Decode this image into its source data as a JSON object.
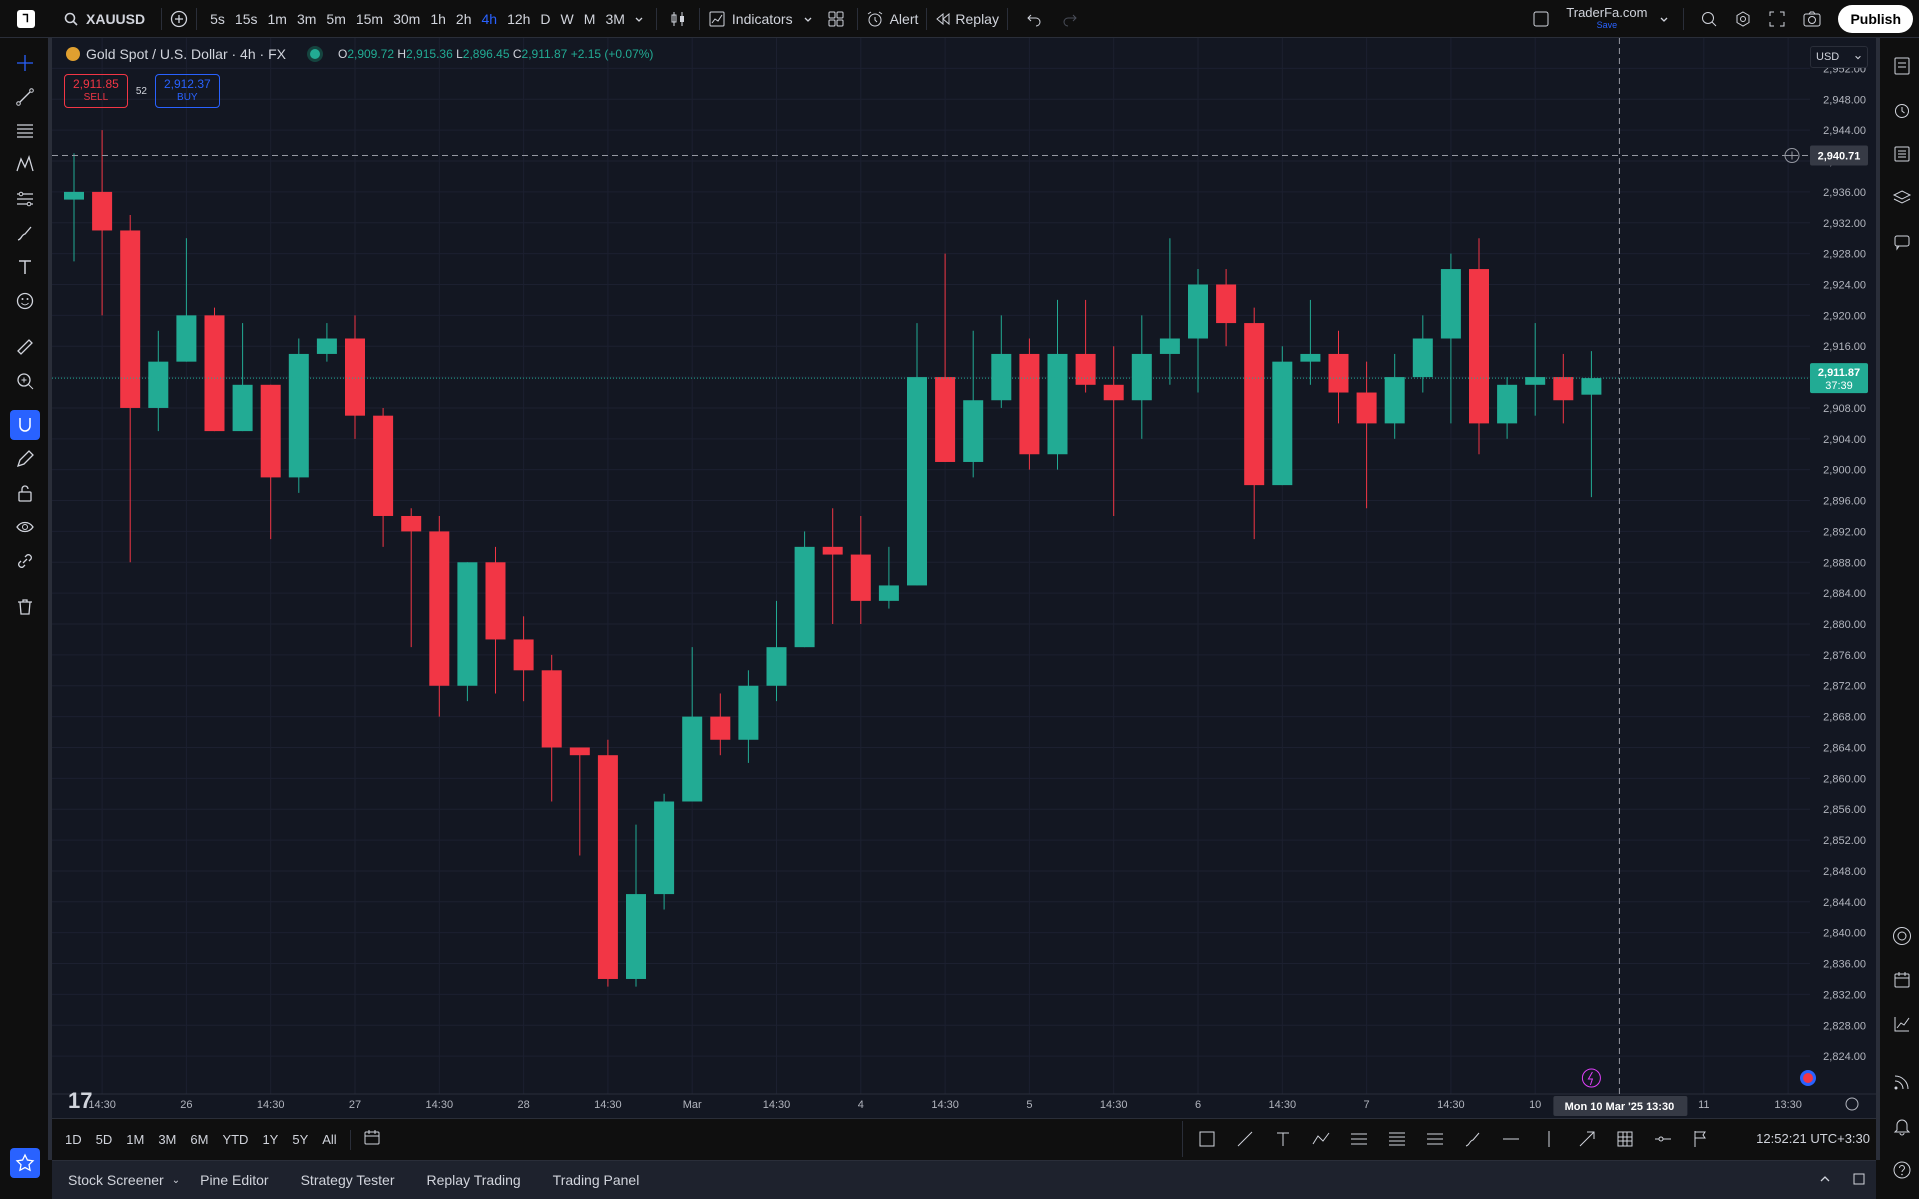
{
  "topbar": {
    "symbol": "XAUUSD",
    "intervals": [
      "5s",
      "15s",
      "1m",
      "3m",
      "5m",
      "15m",
      "30m",
      "1h",
      "2h",
      "4h",
      "12h",
      "D",
      "W",
      "M",
      "3M"
    ],
    "active_interval": "4h",
    "indicators": "Indicators",
    "alert": "Alert",
    "replay": "Replay",
    "layout_name": "TraderFa.com",
    "layout_status": "Save",
    "publish": "Publish"
  },
  "legend": {
    "title": "Gold Spot / U.S. Dollar · 4h · FX",
    "o_label": "O",
    "o": "2,909.72",
    "h_label": "H",
    "h": "2,915.36",
    "l_label": "L",
    "l": "2,896.45",
    "c_label": "C",
    "c": "2,911.87",
    "change": "+2.15 (+0.07%)"
  },
  "trade": {
    "sell_price": "2,911.85",
    "sell": "SELL",
    "spread": "52",
    "buy_price": "2,912.37",
    "buy": "BUY"
  },
  "price_axis": {
    "currency": "USD",
    "crosshair_price": "2,940.71",
    "last_price": "2,911.87",
    "countdown": "37:39"
  },
  "time_axis": {
    "crosshair_label": "Mon 10 Mar '25   13:30"
  },
  "bottombar": {
    "ranges": [
      "1D",
      "5D",
      "1M",
      "3M",
      "6M",
      "YTD",
      "1Y",
      "5Y",
      "All"
    ],
    "clock": "12:52:21 UTC+3:30"
  },
  "footer": {
    "tabs": [
      "Stock Screener",
      "Pine Editor",
      "Strategy Tester",
      "Replay Trading",
      "Trading Panel"
    ]
  },
  "colors": {
    "up": "#22ab94",
    "down": "#f23645",
    "background": "#131722",
    "accent": "#2962ff"
  },
  "chart_data": {
    "type": "candlestick",
    "ylim": [
      2820,
      2956
    ],
    "y_ticks": [
      2952,
      2948,
      2944,
      2940,
      2936,
      2932,
      2928,
      2924,
      2920,
      2916,
      2912,
      2908,
      2904,
      2900,
      2896,
      2892,
      2888,
      2884,
      2880,
      2876,
      2872,
      2868,
      2864,
      2860,
      2856,
      2852,
      2848,
      2844,
      2840,
      2836,
      2832,
      2828,
      2824
    ],
    "y_tick_labels": [
      "2,952.00",
      "2,948.00",
      "2,944.00",
      "2,940.00",
      "2,936.00",
      "2,932.00",
      "2,928.00",
      "2,924.00",
      "2,920.00",
      "2,916.00",
      "2,912.00",
      "2,908.00",
      "2,904.00",
      "2,900.00",
      "2,896.00",
      "2,892.00",
      "2,888.00",
      "2,884.00",
      "2,880.00",
      "2,876.00",
      "2,872.00",
      "2,868.00",
      "2,864.00",
      "2,860.00",
      "2,856.00",
      "2,852.00",
      "2,848.00",
      "2,844.00",
      "2,840.00",
      "2,836.00",
      "2,832.00",
      "2,828.00",
      "2,824.00"
    ],
    "x_ticks": [
      {
        "label": "14:30",
        "i": 1
      },
      {
        "label": "26",
        "i": 4
      },
      {
        "label": "14:30",
        "i": 7
      },
      {
        "label": "27",
        "i": 10
      },
      {
        "label": "14:30",
        "i": 13
      },
      {
        "label": "28",
        "i": 16
      },
      {
        "label": "14:30",
        "i": 19
      },
      {
        "label": "Mar",
        "i": 22
      },
      {
        "label": "14:30",
        "i": 25
      },
      {
        "label": "4",
        "i": 28
      },
      {
        "label": "14:30",
        "i": 31
      },
      {
        "label": "5",
        "i": 34
      },
      {
        "label": "14:30",
        "i": 37
      },
      {
        "label": "6",
        "i": 40
      },
      {
        "label": "14:30",
        "i": 43
      },
      {
        "label": "7",
        "i": 46
      },
      {
        "label": "14:30",
        "i": 49
      },
      {
        "label": "10",
        "i": 52
      },
      {
        "label": "11",
        "i": 58
      },
      {
        "label": "13:30",
        "i": 61
      }
    ],
    "candles": [
      {
        "o": 2935,
        "h": 2941,
        "l": 2927,
        "c": 2936
      },
      {
        "o": 2936,
        "h": 2944,
        "l": 2920,
        "c": 2931
      },
      {
        "o": 2931,
        "h": 2933,
        "l": 2888,
        "c": 2908
      },
      {
        "o": 2908,
        "h": 2918,
        "l": 2905,
        "c": 2914
      },
      {
        "o": 2914,
        "h": 2930,
        "l": 2914,
        "c": 2920
      },
      {
        "o": 2920,
        "h": 2921,
        "l": 2905,
        "c": 2905
      },
      {
        "o": 2905,
        "h": 2919,
        "l": 2905,
        "c": 2911
      },
      {
        "o": 2911,
        "h": 2911,
        "l": 2891,
        "c": 2899
      },
      {
        "o": 2899,
        "h": 2917,
        "l": 2897,
        "c": 2915
      },
      {
        "o": 2915,
        "h": 2919,
        "l": 2914,
        "c": 2917
      },
      {
        "o": 2917,
        "h": 2920,
        "l": 2904,
        "c": 2907
      },
      {
        "o": 2907,
        "h": 2908,
        "l": 2890,
        "c": 2894
      },
      {
        "o": 2894,
        "h": 2895,
        "l": 2877,
        "c": 2892
      },
      {
        "o": 2892,
        "h": 2894,
        "l": 2868,
        "c": 2872
      },
      {
        "o": 2872,
        "h": 2888,
        "l": 2870,
        "c": 2888
      },
      {
        "o": 2888,
        "h": 2890,
        "l": 2871,
        "c": 2878
      },
      {
        "o": 2878,
        "h": 2881,
        "l": 2870,
        "c": 2874
      },
      {
        "o": 2874,
        "h": 2876,
        "l": 2857,
        "c": 2864
      },
      {
        "o": 2864,
        "h": 2864,
        "l": 2850,
        "c": 2863
      },
      {
        "o": 2863,
        "h": 2865,
        "l": 2833,
        "c": 2834
      },
      {
        "o": 2834,
        "h": 2854,
        "l": 2833,
        "c": 2845
      },
      {
        "o": 2845,
        "h": 2858,
        "l": 2843,
        "c": 2857
      },
      {
        "o": 2857,
        "h": 2877,
        "l": 2857,
        "c": 2868
      },
      {
        "o": 2868,
        "h": 2871,
        "l": 2863,
        "c": 2865
      },
      {
        "o": 2865,
        "h": 2874,
        "l": 2862,
        "c": 2872
      },
      {
        "o": 2872,
        "h": 2883,
        "l": 2870,
        "c": 2877
      },
      {
        "o": 2877,
        "h": 2892,
        "l": 2877,
        "c": 2890
      },
      {
        "o": 2890,
        "h": 2895,
        "l": 2880,
        "c": 2889
      },
      {
        "o": 2889,
        "h": 2894,
        "l": 2880,
        "c": 2883
      },
      {
        "o": 2883,
        "h": 2890,
        "l": 2882,
        "c": 2885
      },
      {
        "o": 2885,
        "h": 2919,
        "l": 2885,
        "c": 2912
      },
      {
        "o": 2912,
        "h": 2928,
        "l": 2901,
        "c": 2901
      },
      {
        "o": 2901,
        "h": 2918,
        "l": 2899,
        "c": 2909
      },
      {
        "o": 2909,
        "h": 2920,
        "l": 2908,
        "c": 2915
      },
      {
        "o": 2915,
        "h": 2917,
        "l": 2900,
        "c": 2902
      },
      {
        "o": 2902,
        "h": 2922,
        "l": 2900,
        "c": 2915
      },
      {
        "o": 2915,
        "h": 2922,
        "l": 2910,
        "c": 2911
      },
      {
        "o": 2911,
        "h": 2916,
        "l": 2894,
        "c": 2909
      },
      {
        "o": 2909,
        "h": 2920,
        "l": 2904,
        "c": 2915
      },
      {
        "o": 2915,
        "h": 2930,
        "l": 2911,
        "c": 2917
      },
      {
        "o": 2917,
        "h": 2926,
        "l": 2910,
        "c": 2924
      },
      {
        "o": 2924,
        "h": 2926,
        "l": 2916,
        "c": 2919
      },
      {
        "o": 2919,
        "h": 2921,
        "l": 2891,
        "c": 2898
      },
      {
        "o": 2898,
        "h": 2916,
        "l": 2898,
        "c": 2914
      },
      {
        "o": 2914,
        "h": 2922,
        "l": 2911,
        "c": 2915
      },
      {
        "o": 2915,
        "h": 2918,
        "l": 2906,
        "c": 2910
      },
      {
        "o": 2910,
        "h": 2914,
        "l": 2895,
        "c": 2906
      },
      {
        "o": 2906,
        "h": 2915,
        "l": 2904,
        "c": 2912
      },
      {
        "o": 2912,
        "h": 2920,
        "l": 2910,
        "c": 2917
      },
      {
        "o": 2917,
        "h": 2928,
        "l": 2906,
        "c": 2926
      },
      {
        "o": 2926,
        "h": 2930,
        "l": 2902,
        "c": 2906
      },
      {
        "o": 2906,
        "h": 2912,
        "l": 2904,
        "c": 2911
      },
      {
        "o": 2911,
        "h": 2919,
        "l": 2907,
        "c": 2912
      },
      {
        "o": 2912,
        "h": 2915,
        "l": 2906,
        "c": 2909
      },
      {
        "o": 2909.72,
        "h": 2915.36,
        "l": 2896.45,
        "c": 2911.87
      }
    ]
  }
}
